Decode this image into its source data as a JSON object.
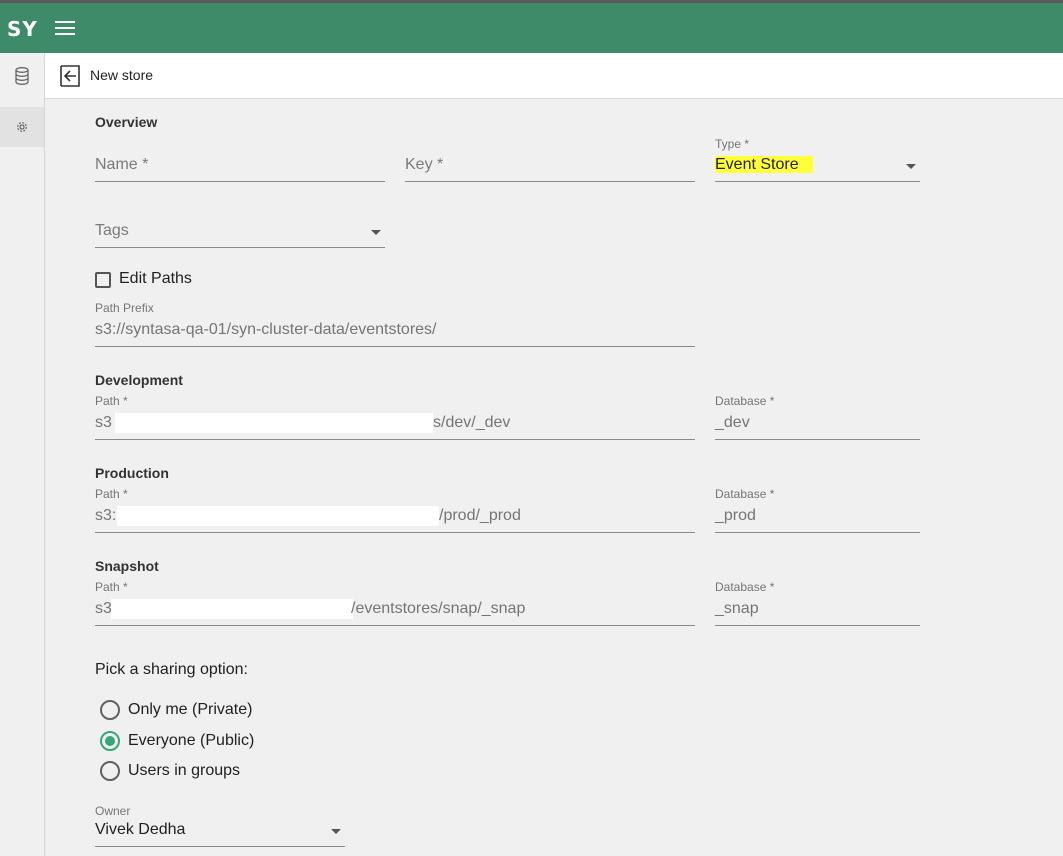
{
  "app": {
    "logo": "SY"
  },
  "header": {
    "title": "New store"
  },
  "overview": {
    "section_title": "Overview",
    "name_placeholder": "Name *",
    "key_placeholder": "Key *",
    "type_label": "Type *",
    "type_value": "Event Store",
    "tags_placeholder": "Tags"
  },
  "edit_paths": {
    "label": "Edit Paths",
    "checked": false
  },
  "path_prefix": {
    "label": "Path Prefix",
    "value": "s3://syntasa-qa-01/syn-cluster-data/eventstores/"
  },
  "development": {
    "section_title": "Development",
    "path_label": "Path *",
    "path_start": "s3",
    "path_end": "s/dev/_dev",
    "database_label": "Database *",
    "database_value": "_dev"
  },
  "production": {
    "section_title": "Production",
    "path_label": "Path *",
    "path_start": "s3:",
    "path_end": "/prod/_prod",
    "database_label": "Database *",
    "database_value": "_prod"
  },
  "snapshot": {
    "section_title": "Snapshot",
    "path_label": "Path *",
    "path_start": "s3",
    "path_end": "/eventstores/snap/_snap",
    "database_label": "Database *",
    "database_value": "_snap"
  },
  "sharing": {
    "prompt": "Pick a sharing option:",
    "options": [
      {
        "label": "Only me (Private)",
        "selected": false
      },
      {
        "label": "Everyone (Public)",
        "selected": true
      },
      {
        "label": "Users in groups",
        "selected": false
      }
    ]
  },
  "owner": {
    "label": "Owner",
    "value": "Vivek Dedha"
  },
  "colors": {
    "topbar": "#3d8b68",
    "accent": "#3aa57a",
    "highlight": "#ffff3a"
  }
}
